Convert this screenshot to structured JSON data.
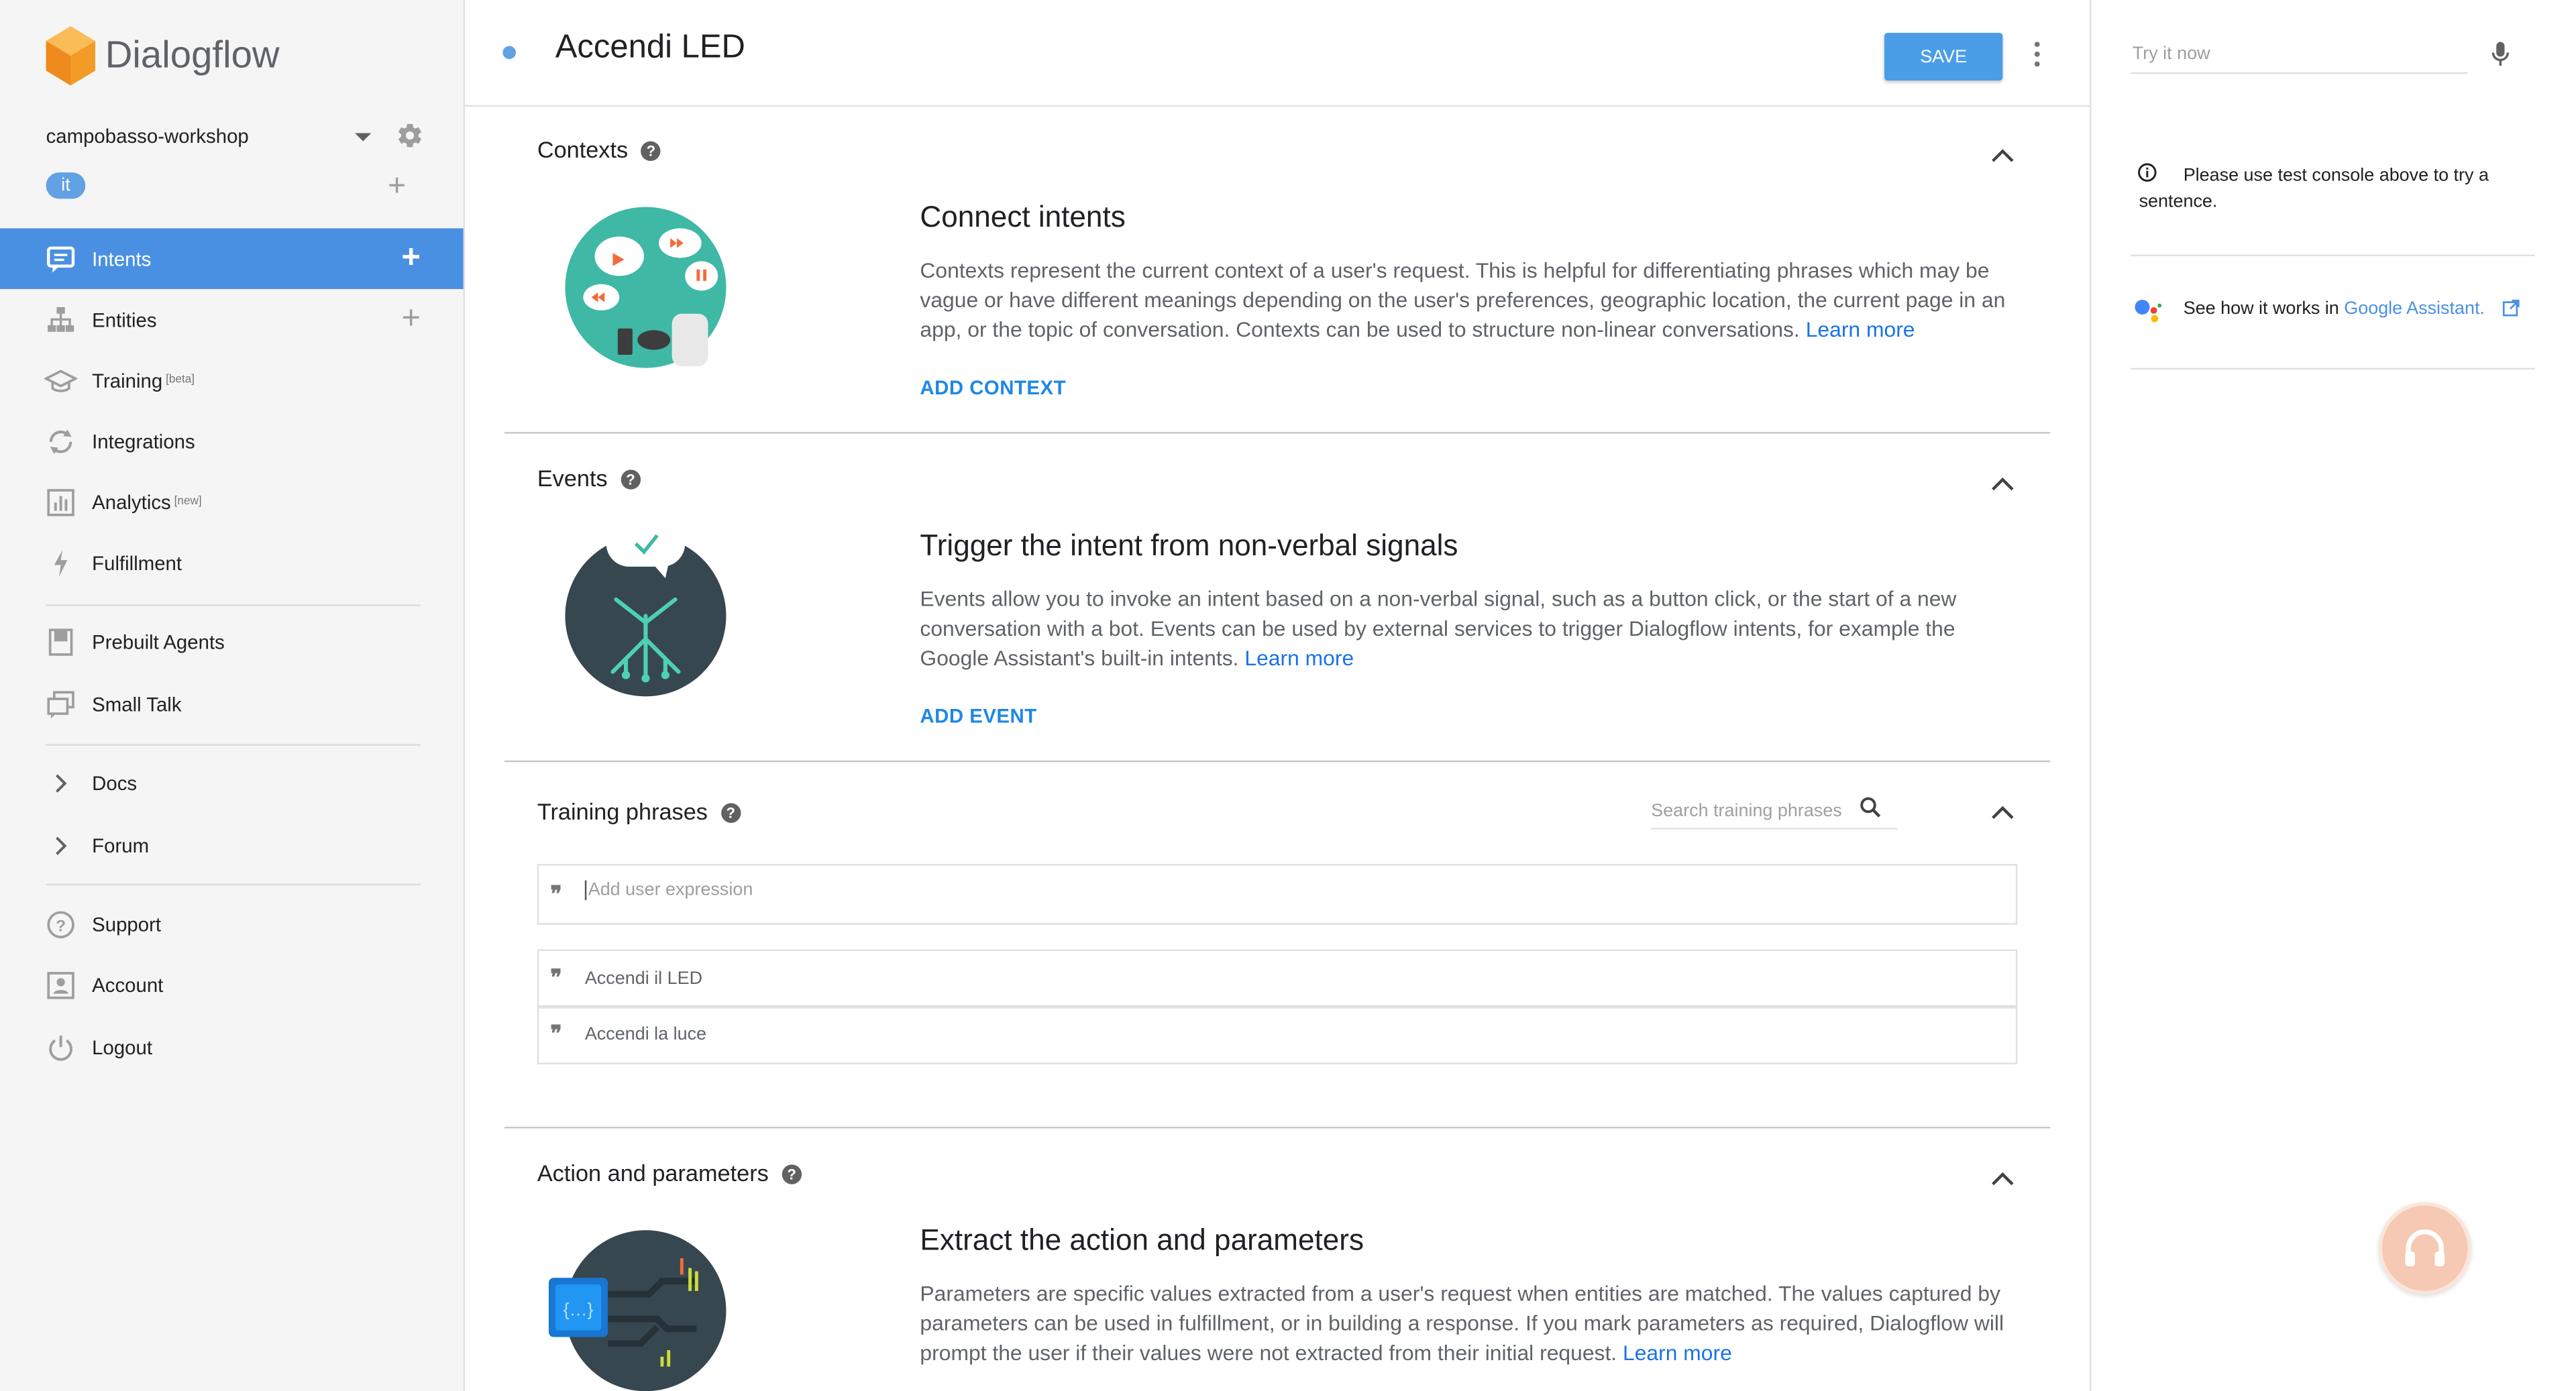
{
  "app": {
    "name": "Dialogflow"
  },
  "agent": {
    "name": "campobasso-workshop",
    "language": "it"
  },
  "sidebar": {
    "items": [
      {
        "label": "Intents",
        "sup": ""
      },
      {
        "label": "Entities",
        "sup": ""
      },
      {
        "label": "Training",
        "sup": "[beta]"
      },
      {
        "label": "Integrations",
        "sup": ""
      },
      {
        "label": "Analytics",
        "sup": "[new]"
      },
      {
        "label": "Fulfillment",
        "sup": ""
      },
      {
        "label": "Prebuilt Agents",
        "sup": ""
      },
      {
        "label": "Small Talk",
        "sup": ""
      },
      {
        "label": "Docs",
        "sup": ""
      },
      {
        "label": "Forum",
        "sup": ""
      },
      {
        "label": "Support",
        "sup": ""
      },
      {
        "label": "Account",
        "sup": ""
      },
      {
        "label": "Logout",
        "sup": ""
      }
    ]
  },
  "header": {
    "intent_name": "Accendi LED",
    "save_label": "SAVE"
  },
  "right_panel": {
    "try_placeholder": "Try it now",
    "info": "Please use test console above to try a sentence.",
    "ga_prefix": "See how it works in ",
    "ga_link": "Google Assistant."
  },
  "sections": {
    "contexts": {
      "title": "Contexts",
      "heading": "Connect intents",
      "desc": "Contexts represent the current context of a user's request. This is helpful for differentiating phrases which may be vague or have different meanings depending on the user's preferences, geographic location, the current page in an app, or the topic of conversation. Contexts can be used to structure non-linear conversations.",
      "learn_more": "Learn more",
      "action": "ADD CONTEXT"
    },
    "events": {
      "title": "Events",
      "heading": "Trigger the intent from non-verbal signals",
      "desc": "Events allow you to invoke an intent based on a non-verbal signal, such as a button click, or the start of a new conversation with a bot. Events can be used by external services to trigger Dialogflow intents, for example the Google Assistant's built-in intents.",
      "learn_more": "Learn more",
      "action": "ADD EVENT"
    },
    "training": {
      "title": "Training phrases",
      "search_placeholder": "Search training phrases",
      "add_placeholder": "Add user expression",
      "phrases": [
        "Accendi il LED",
        "Accendi la luce"
      ]
    },
    "action_params": {
      "title": "Action and parameters",
      "heading": "Extract the action and parameters",
      "desc": "Parameters are specific values extracted from a user's request when entities are matched. The values captured by parameters can be used in fulfillment, or in building a response. If you mark parameters as required, Dialogflow will prompt the user if their values were not extracted from their initial request.",
      "learn_more": "Learn more"
    }
  },
  "colors": {
    "accent": "#4a90e2",
    "save": "#4a9ee8",
    "link": "#1a73e8"
  },
  "icons": [
    "dialogflow-logo-icon",
    "chevron-down-icon",
    "gear-icon",
    "plus-icon",
    "chat-icon",
    "entities-icon",
    "training-cap-icon",
    "integrations-icon",
    "analytics-icon",
    "lightning-icon",
    "book-icon",
    "small-talk-icon",
    "chevron-right-icon",
    "help-circle-icon",
    "account-icon",
    "power-icon",
    "kebab-icon",
    "mic-icon",
    "info-icon",
    "google-assistant-icon",
    "external-link-icon",
    "search-icon",
    "chevron-up-icon",
    "quote-icon",
    "headset-icon"
  ]
}
